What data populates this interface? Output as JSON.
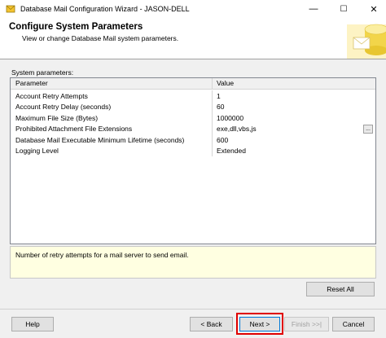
{
  "window": {
    "title": "Database Mail Configuration Wizard - JASON-DELL",
    "minimize_glyph": "—",
    "maximize_glyph": "☐",
    "close_glyph": "✕"
  },
  "header": {
    "title": "Configure System Parameters",
    "subtitle": "View or change Database Mail system parameters."
  },
  "section_label": "System parameters:",
  "grid": {
    "columns": [
      "Parameter",
      "Value"
    ],
    "rows": [
      {
        "name": "Account Retry Attempts",
        "value": "1"
      },
      {
        "name": "Account Retry Delay (seconds)",
        "value": "60"
      },
      {
        "name": "Maximum File Size (Bytes)",
        "value": "1000000"
      },
      {
        "name": "Prohibited Attachment File Extensions",
        "value": "exe,dll,vbs,js"
      },
      {
        "name": "Database Mail Executable Minimum Lifetime (seconds)",
        "value": "600"
      },
      {
        "name": "Logging Level",
        "value": "Extended"
      }
    ],
    "ellipsis_label": "..."
  },
  "description": "Number of retry attempts for a mail server to send email.",
  "buttons": {
    "reset_all": "Reset All",
    "help": "Help",
    "back": "< Back",
    "next": "Next >",
    "finish": "Finish >>|",
    "cancel": "Cancel"
  },
  "colors": {
    "highlight": "#e00000",
    "description_bg": "#ffffe1"
  }
}
